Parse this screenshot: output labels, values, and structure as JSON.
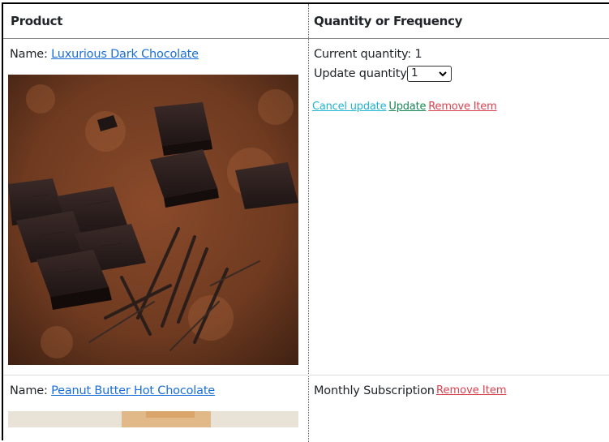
{
  "table": {
    "headers": {
      "product": "Product",
      "quantity": "Quantity or Frequency"
    },
    "rows": [
      {
        "name_label": "Name:",
        "product_name": "Luxurious Dark Chocolate",
        "current_quantity_label": "Current quantity: 1",
        "update_quantity_label": "Update quantity",
        "quantity_selected": "1",
        "actions": {
          "cancel": "Cancel update",
          "update": "Update",
          "remove": "Remove Item"
        }
      },
      {
        "name_label": "Name:",
        "product_name": "Peanut Butter Hot Chocolate",
        "frequency": "Monthly Subscription",
        "actions": {
          "remove": "Remove Item"
        }
      }
    ]
  },
  "colors": {
    "link": "#1a6ed8",
    "cancel": "#1fb4d2",
    "update": "#198754",
    "remove": "#d9414f"
  },
  "icons": {
    "select_arrow": "chevron-down-icon"
  }
}
